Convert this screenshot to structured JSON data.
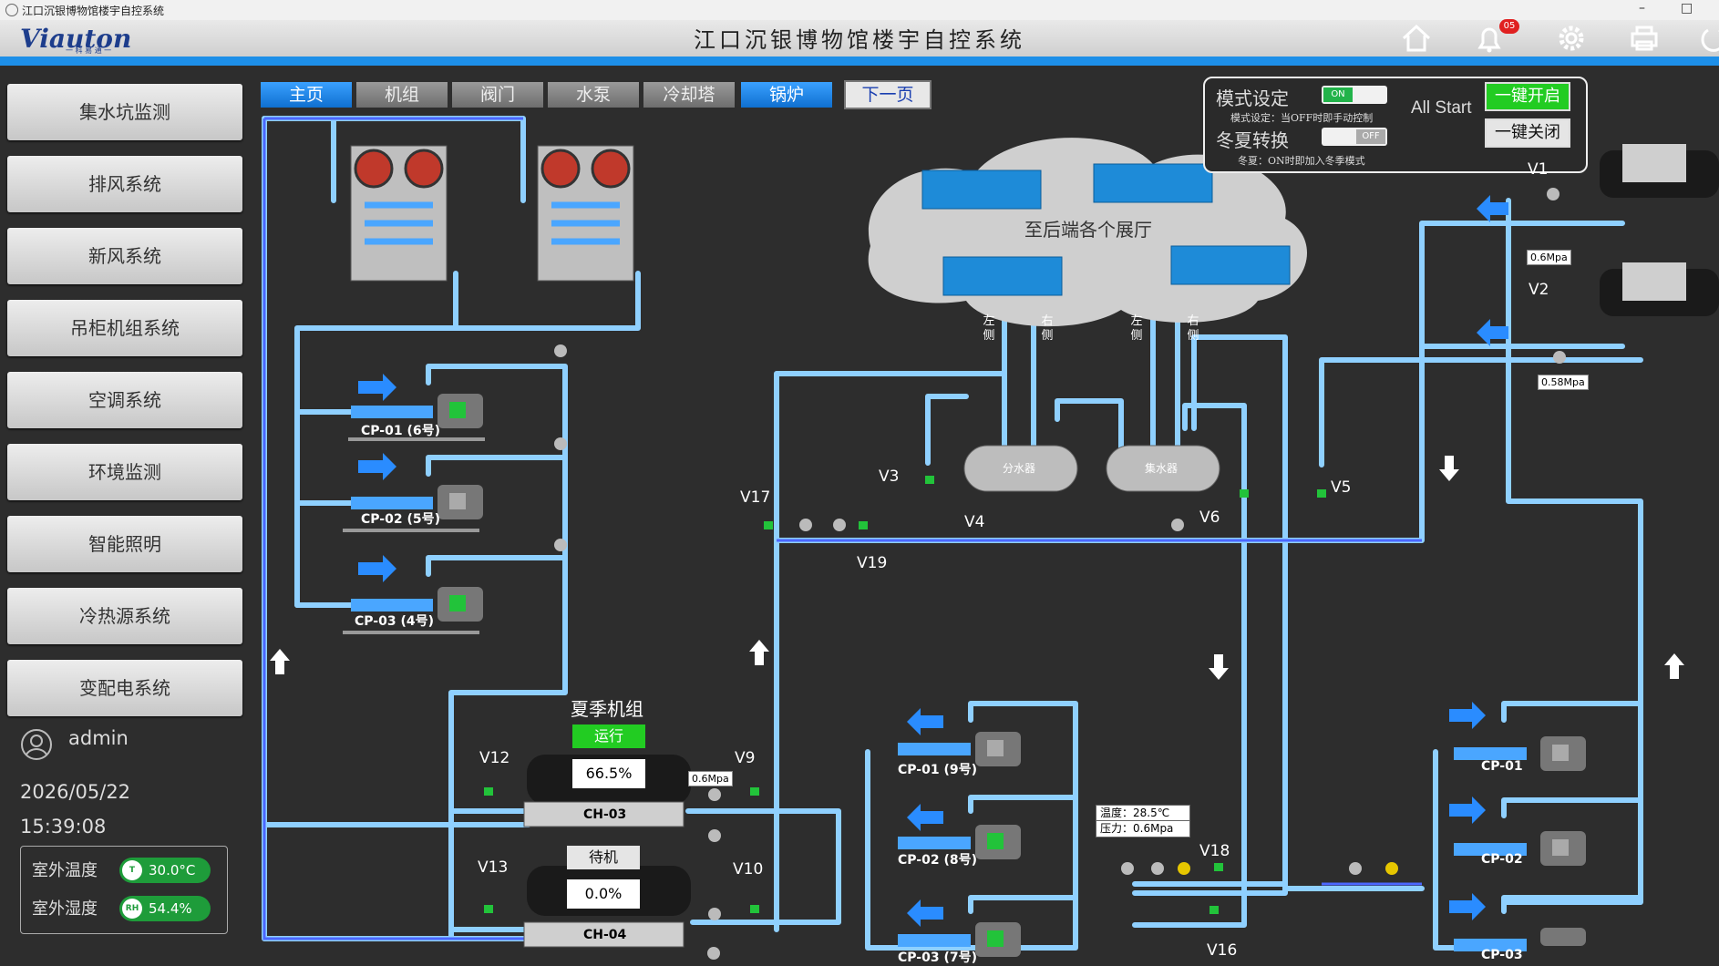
{
  "window": {
    "title": "江口沉银博物馆楼宇自控系统",
    "minimize": "–",
    "restore": "□"
  },
  "header": {
    "logo": "Viauton",
    "logo_sub": "一 科 易 通 一",
    "title": "江口沉银博物馆楼宇自控系统",
    "notification_count": "05",
    "accent": "#1d8fe8"
  },
  "sidebar": {
    "items": [
      {
        "label": "集水坑监测"
      },
      {
        "label": "排风系统"
      },
      {
        "label": "新风系统"
      },
      {
        "label": "吊柜机组系统"
      },
      {
        "label": "空调系统"
      },
      {
        "label": "环境监测"
      },
      {
        "label": "智能照明"
      },
      {
        "label": "冷热源系统"
      },
      {
        "label": "变配电系统"
      }
    ],
    "user": "admin",
    "date": "2026/05/22",
    "time": "15:39:08",
    "env": {
      "temp_label": "室外温度",
      "temp_value": "30.0°C",
      "temp_icon_text": "T",
      "hum_label": "室外湿度",
      "hum_value": "54.4%",
      "hum_icon_text": "RH"
    }
  },
  "tabs": [
    {
      "label": "主页",
      "style": "blue"
    },
    {
      "label": "机组",
      "style": "gray"
    },
    {
      "label": "阀门",
      "style": "gray"
    },
    {
      "label": "水泵",
      "style": "gray"
    },
    {
      "label": "冷却塔",
      "style": "gray"
    },
    {
      "label": "锅炉",
      "style": "blue"
    },
    {
      "label": "下一页",
      "style": "next"
    }
  ],
  "control": {
    "mode_label": "模式设定",
    "mode_toggle": "ON",
    "mode_note": "模式设定：当OFF时即手动控制",
    "season_label": "冬夏转换",
    "season_toggle": "OFF",
    "season_note": "冬夏：ON时即加入冬季模式",
    "all_start": "All Start",
    "start_button": "一键开启",
    "stop_button": "一键关闭"
  },
  "terminal": {
    "cloud_label": "至后端各个展厅",
    "left": "左侧",
    "right": "右侧",
    "distributor": "分水器",
    "collector": "集水器"
  },
  "chillers": {
    "group_label": "夏季机组",
    "ch03": {
      "name": "CH-03",
      "status": "运行",
      "load": "66.5%"
    },
    "ch04": {
      "name": "CH-04",
      "status": "待机",
      "load": "0.0%"
    }
  },
  "pumps": {
    "cooling": [
      "CP-01 (6号)",
      "CP-02 (5号)",
      "CP-03 (4号)"
    ],
    "chilled": [
      "CP-01 (9号)",
      "CP-02 (8号)",
      "CP-03 (7号)"
    ],
    "right": [
      "CP-01",
      "CP-02",
      "CP-03"
    ]
  },
  "valves": [
    "V1",
    "V2",
    "V3",
    "V4",
    "V5",
    "V6",
    "V9",
    "V10",
    "V12",
    "V13",
    "V16",
    "V17",
    "V18",
    "V19"
  ],
  "pressures": {
    "ch03": "0.6Mpa",
    "v1": "0.6Mpa",
    "v2": "0.58Mpa"
  },
  "sensor": {
    "temp": "温度：28.5℃",
    "pressure": "压力：0.6Mpa"
  }
}
